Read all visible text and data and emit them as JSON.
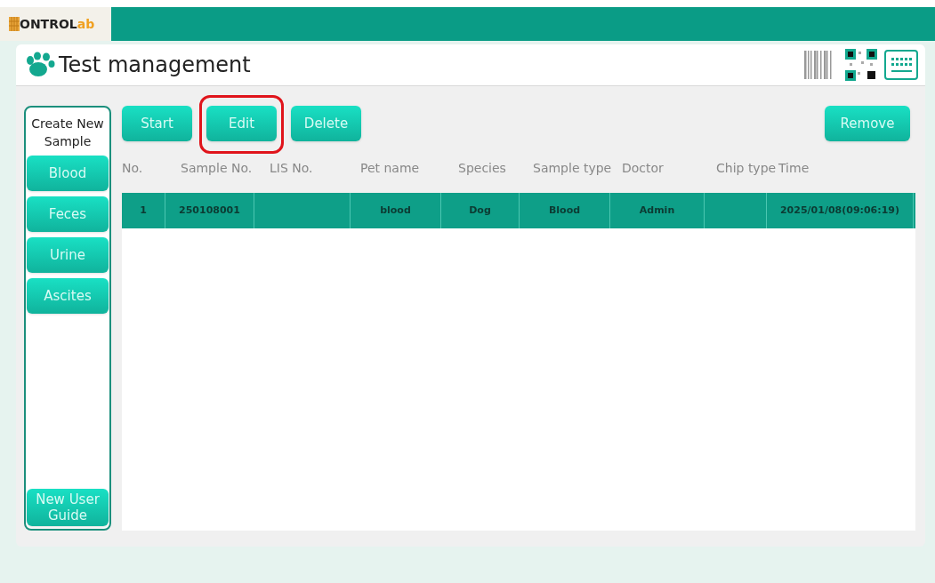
{
  "logo": {
    "main": "ONTROL",
    "accent": "ab"
  },
  "title": "Test management",
  "sidebar": {
    "heading": "Create New Sample",
    "items": [
      {
        "label": "Blood"
      },
      {
        "label": "Feces"
      },
      {
        "label": "Urine"
      },
      {
        "label": "Ascites"
      }
    ],
    "guide": "New User Guide"
  },
  "toolbar": [
    {
      "label": "Start",
      "highlighted": false
    },
    {
      "label": "Edit",
      "highlighted": true
    },
    {
      "label": "Delete",
      "highlighted": false
    }
  ],
  "remove_button": "Remove",
  "table": {
    "columns": [
      "No.",
      "Sample No.",
      "LIS No.",
      "Pet name",
      "Species",
      "Sample type",
      "Doctor",
      "Chip type",
      "Time"
    ],
    "rows": [
      {
        "selected": true,
        "cells": [
          "1",
          "250108001",
          "",
          "blood",
          "Dog",
          "Blood",
          "Admin",
          "",
          "2025/01/08(09:06:19)"
        ]
      }
    ]
  }
}
